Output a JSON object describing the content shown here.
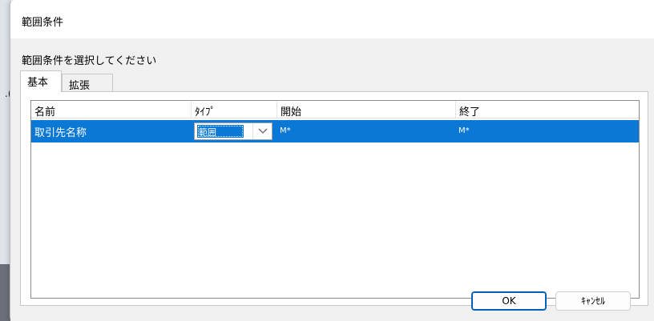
{
  "window": {
    "title": "範囲条件"
  },
  "dialog": {
    "instruction": "範囲条件を選択してください"
  },
  "tabs": [
    {
      "label": "基本",
      "selected": true
    },
    {
      "label": "拡張",
      "selected": false
    }
  ],
  "list": {
    "columns": [
      "名前",
      "ﾀｲﾌﾟ",
      "開始",
      "終了"
    ],
    "rows": [
      {
        "name": "取引先名称",
        "type": "範囲",
        "start": "M*",
        "end": "M*",
        "selected": true
      }
    ]
  },
  "buttons": {
    "ok": "OK",
    "cancel": "ｷｬﾝｾﾙ"
  },
  "background": {
    "glyph": ".("
  },
  "colors": {
    "selection": "#0a78d4",
    "face": "#f0f0f0"
  },
  "icons": {
    "dropdown": "chevron-down-icon"
  }
}
